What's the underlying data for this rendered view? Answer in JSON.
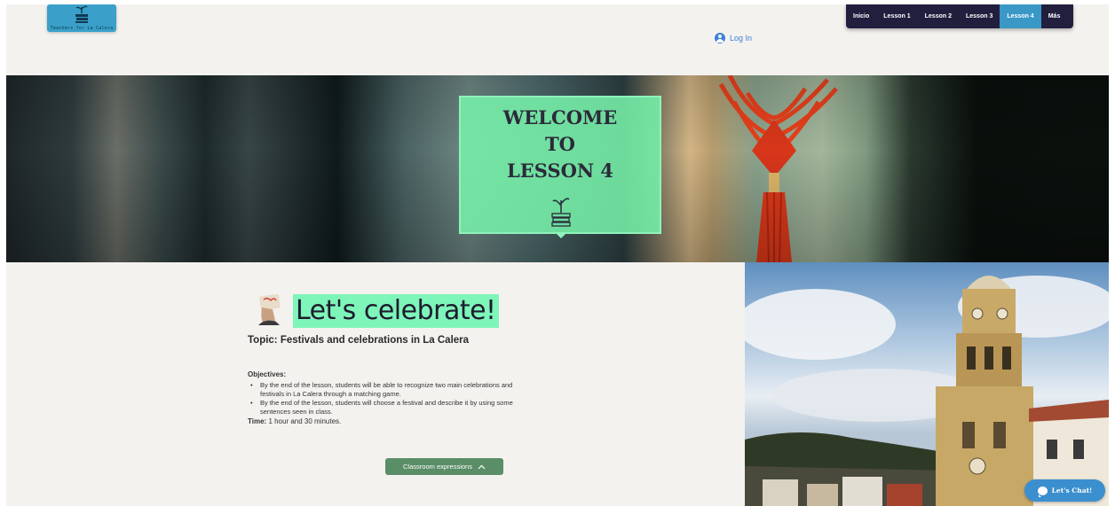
{
  "header": {
    "logo_text": "Teachers for La Calera",
    "login_label": "Log In",
    "nav": [
      {
        "label": "Inicio",
        "active": false
      },
      {
        "label": "Lesson 1",
        "active": false
      },
      {
        "label": "Lesson 2",
        "active": false
      },
      {
        "label": "Lesson 3",
        "active": false
      },
      {
        "label": "Lesson 4",
        "active": true
      },
      {
        "label": "Más",
        "active": false
      }
    ]
  },
  "hero": {
    "welcome_lines": [
      "WELCOME",
      "TO",
      "LESSON 4"
    ]
  },
  "content": {
    "title": "Let's celebrate!",
    "topic": "Topic: Festivals and celebrations in La Calera",
    "objectives_heading": "Objectives:",
    "objectives": [
      "By the end of the lesson, students will be able to recognize two main celebrations and festivals in La Calera through a matching game.",
      "By the end of the lesson, students will choose a festival and describe it by using some sentences seen in class."
    ],
    "time_label": "Time:",
    "time_value": "1 hour and 30 minutes.",
    "expressions_button": "Classroom expressions"
  },
  "chat": {
    "label": "Let's Chat!"
  },
  "colors": {
    "nav_bg": "#221e3d",
    "nav_active": "#3a98c6",
    "highlight": "#7ef5b9",
    "button_green": "#5a8e66",
    "chat_blue": "#3b8fce"
  }
}
